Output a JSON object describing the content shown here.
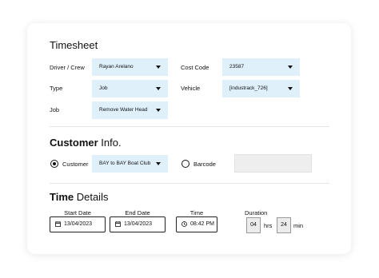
{
  "timesheet": {
    "title": "Timesheet",
    "driver_label": "Driver / Crew",
    "driver_value": "Rayan Arelano",
    "type_label": "Type",
    "type_value": "Job",
    "job_label": "Job",
    "job_value": "Remove Water Head",
    "cost_code_label": "Cost Code",
    "cost_code_value": "23587",
    "vehicle_label": "Vehicle",
    "vehicle_value": "[industrack_726]"
  },
  "customer_info": {
    "title_bold": "Customer",
    "title_rest": " Info.",
    "customer_label": "Customer",
    "customer_value": "BAY to BAY Boat Club",
    "barcode_label": "Barcode",
    "selected": "customer"
  },
  "time_details": {
    "title_bold": "Time",
    "title_rest": " Details",
    "start_date_label": "Start Date",
    "start_date_value": "13/04/2023",
    "end_date_label": "End Date",
    "end_date_value": "13/04/2023",
    "time_label": "Time",
    "time_value": "08:42 PM",
    "duration_label": "Duration",
    "duration_hours": "04",
    "hours_unit": "hrs",
    "duration_minutes": "24",
    "minutes_unit": "min"
  },
  "colors": {
    "select_bg": "#dff0fb",
    "input_grey": "#eeeeee"
  }
}
